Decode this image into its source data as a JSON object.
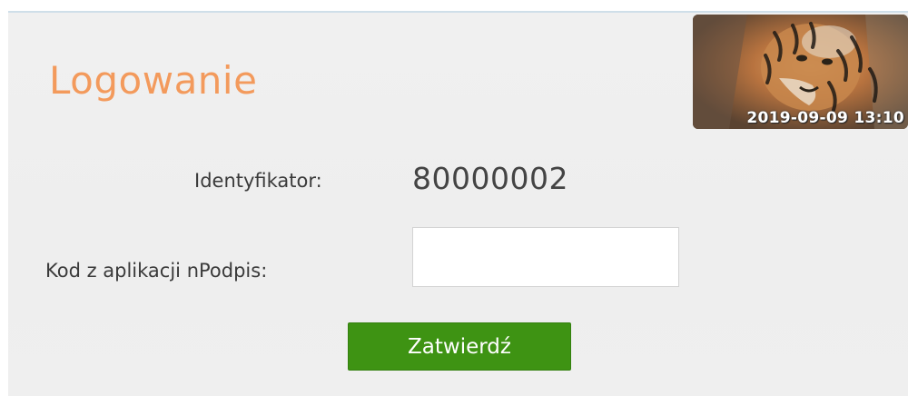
{
  "login": {
    "title": "Logowanie",
    "id_label": "Identyfikator:",
    "id_value": "80000002",
    "code_label": "Kod z aplikacji nPodpis:",
    "code_value": "",
    "submit_label": "Zatwierdź"
  },
  "security_image": {
    "icon": "tiger-photo",
    "timestamp": "2019-09-09 13:10"
  },
  "colors": {
    "title": "#f39a5c",
    "submit_bg": "#3e9313"
  }
}
